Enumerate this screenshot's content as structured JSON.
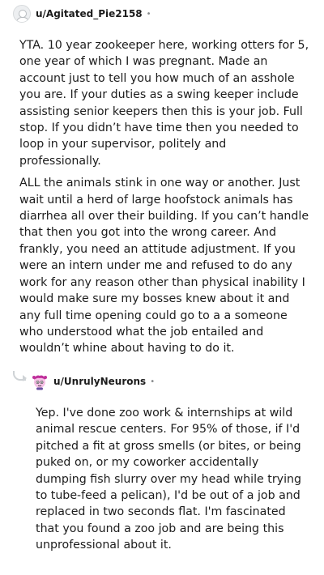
{
  "comment1": {
    "username": "u/Agitated_Pie2158",
    "separator": "•",
    "paragraphs": [
      "YTA. 10 year zookeeper here, working otters for 5, one year of which I was pregnant. Made an account just to tell you how much of an asshole you are. If your duties as a swing keeper include assisting senior keepers then this is your job. Full stop. If you didn’t have time then you needed to loop in your supervisor, politely and professionally.",
      "ALL the animals stink in one way or another. Just wait until a herd of large hoofstock animals has diarrhea all over their building. If you can’t handle that then you got into the wrong career. And frankly, you need an attitude adjustment. If you were an intern under me and refused to do any work for any reason other than physical inability I would make sure my bosses knew about it and any full time opening could go to a a someone who understood what the job entailed and wouldn’t whine about having to do it."
    ]
  },
  "comment2": {
    "username": "u/UnrulyNeurons",
    "separator": "•",
    "paragraphs": [
      "Yep. I've done zoo work & internships at wild animal rescue centers. For 95% of those, if I'd pitched a fit at gross smells (or bites, or being puked on, or my coworker accidentally dumping fish slurry over my head while trying to tube-feed a pelican), I'd be out of a job and replaced in two seconds flat. I'm fascinated that you found a zoo job and are being this unprofessional about it."
    ]
  }
}
